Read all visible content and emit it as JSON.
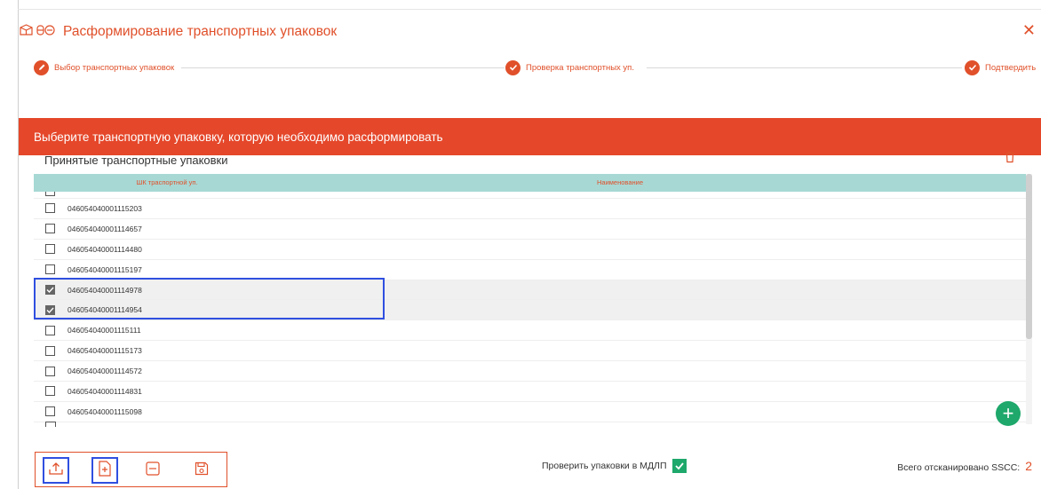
{
  "header": {
    "title": "Расформирование транспортных упаковок",
    "close_glyph": "✕",
    "icons": [
      "box-icon",
      "cubes-icon"
    ]
  },
  "stepper": {
    "steps": [
      {
        "label": "Выбор транспортных упаковок",
        "icon": "pencil-icon"
      },
      {
        "label": "Проверка транспортных уп.",
        "icon": "check-icon"
      },
      {
        "label": "Подтвердить",
        "icon": "check-icon"
      }
    ]
  },
  "banner": {
    "text": "Выберите транспортную упаковку, которую необходимо расформировать"
  },
  "section": {
    "title": "Принятые транспортные упаковки"
  },
  "table": {
    "columns": [
      "ШК траспортной уп.",
      "Наименование"
    ],
    "rows": [
      {
        "code": "046054040001115203",
        "checked": false
      },
      {
        "code": "046054040001114657",
        "checked": false
      },
      {
        "code": "046054040001114480",
        "checked": false
      },
      {
        "code": "046054040001115197",
        "checked": false
      },
      {
        "code": "046054040001114978",
        "checked": true
      },
      {
        "code": "046054040001114954",
        "checked": true
      },
      {
        "code": "046054040001115111",
        "checked": false
      },
      {
        "code": "046054040001115173",
        "checked": false
      },
      {
        "code": "046054040001114572",
        "checked": false
      },
      {
        "code": "046054040001114831",
        "checked": false
      },
      {
        "code": "046054040001115098",
        "checked": false
      }
    ]
  },
  "footer": {
    "fab_glyph": "+",
    "verify_label": "Проверить упаковки в МДЛП",
    "verify_checked": true,
    "total_label": "Всего отсканировано SSCC:",
    "total_value": "2"
  },
  "colors": {
    "accent": "#e0502a",
    "banner": "#e5472a",
    "table_header": "#a7d8d4",
    "success": "#1ea86b",
    "highlight": "#2f4fe0"
  }
}
